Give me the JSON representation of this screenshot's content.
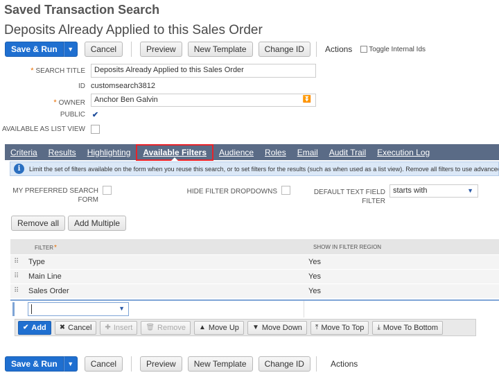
{
  "header": {
    "record_type": "Saved Transaction Search",
    "search_name": "Deposits Already Applied to this Sales Order"
  },
  "toolbar": {
    "save_run": "Save & Run",
    "cancel": "Cancel",
    "preview": "Preview",
    "new_template": "New Template",
    "change_id": "Change ID",
    "actions": "Actions",
    "toggle_internal_ids": "Toggle Internal Ids"
  },
  "form": {
    "search_title_label": "SEARCH TITLE",
    "search_title_value": "Deposits Already Applied to this Sales Order",
    "id_label": "ID",
    "id_value": "customsearch3812",
    "owner_label": "OWNER",
    "owner_value": "Anchor Ben Galvin",
    "public_label": "PUBLIC",
    "public_checked": true,
    "available_list_view_label": "AVAILABLE AS LIST VIEW",
    "available_list_view_checked": false
  },
  "tabs": [
    {
      "label": "Criteria",
      "active": false
    },
    {
      "label": "Results",
      "active": false
    },
    {
      "label": "Highlighting",
      "active": false
    },
    {
      "label": "Available Filters",
      "active": true
    },
    {
      "label": "Audience",
      "active": false
    },
    {
      "label": "Roles",
      "active": false
    },
    {
      "label": "Email",
      "active": false
    },
    {
      "label": "Audit Trail",
      "active": false
    },
    {
      "label": "Execution Log",
      "active": false
    }
  ],
  "info": {
    "text": "Limit the set of filters available on the form when you reuse this search, or to set filters for the results (such as when used as a list view). Remove all filters to use advanced search"
  },
  "filter_options": {
    "my_preferred_label_1": "MY PREFERRED SEARCH",
    "my_preferred_label_2": "FORM",
    "hide_filter_dropdowns_label": "HIDE FILTER DROPDOWNS",
    "default_text_filter_label": "DEFAULT TEXT FIELD FILTER",
    "default_text_filter_value": "starts with"
  },
  "list_buttons": {
    "remove_all": "Remove all",
    "add_multiple": "Add Multiple"
  },
  "grid": {
    "columns": [
      "FILTER",
      "SHOW IN FILTER REGION"
    ],
    "rows": [
      {
        "filter": "Type",
        "show": "Yes"
      },
      {
        "filter": "Main Line",
        "show": "Yes"
      },
      {
        "filter": "Sales Order",
        "show": "Yes"
      }
    ]
  },
  "edit_buttons": {
    "add": "Add",
    "cancel": "Cancel",
    "insert": "Insert",
    "remove": "Remove",
    "move_up": "Move Up",
    "move_down": "Move Down",
    "move_to_top": "Move To Top",
    "move_to_bottom": "Move To Bottom"
  },
  "colors": {
    "primary": "#1f6fd0",
    "tabbar": "#5a6b86",
    "active_tab_outline": "#e8232a",
    "required": "#e86d00",
    "info_bg": "#dbe8f7"
  }
}
